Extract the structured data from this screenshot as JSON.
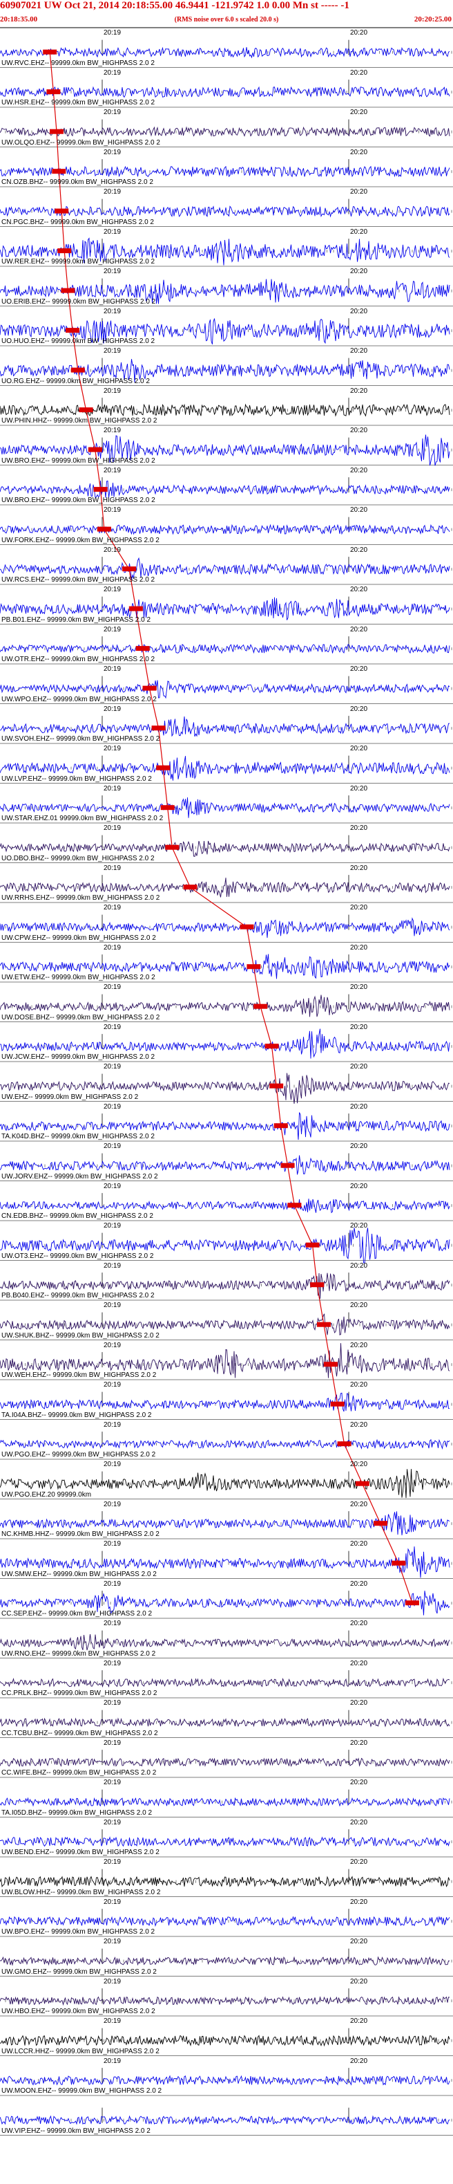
{
  "header": {
    "title": "60907021 UW Oct 21, 2014 20:18:55.00   46.9441 -121.9742   1.0 0.00 Mn st ----- -1",
    "start_time": "20:18:35.00",
    "note": "(RMS noise over 6.0 s scaled 20.0 s)",
    "end_time": "20:20:25.00"
  },
  "tick_labels": {
    "t1": "20:19",
    "t2": "20:20"
  },
  "colors": {
    "trace_blue": "#0000ee",
    "trace_dark": "#2a0f5e",
    "trace_black": "#000000",
    "pick_red": "#dd0000",
    "text_red": "#d40000"
  },
  "channels": [
    {
      "label": "UW.RVC.EHZ-- 99999.0km BW_HIGHPASS  2.0  2",
      "color": "blue",
      "amp": 0.35,
      "bursts": [
        [
          0.56,
          0.1
        ]
      ],
      "pick": 0.11,
      "tick1_label": false
    },
    {
      "label": "UW.HSR.EHZ-- 99999.0km BW_HIGHPASS  2.0  2",
      "color": "blue",
      "amp": 0.4,
      "bursts": [],
      "pick": 0.118,
      "tick1_label": false
    },
    {
      "label": "UW.OLQO.EHZ-- 99999.0km BW_HIGHPASS  2.0  2",
      "color": "dark",
      "amp": 0.35,
      "bursts": [],
      "pick": 0.125,
      "tick1_label": false
    },
    {
      "label": "CN.OZB.BHZ-- 99999.0km BW_HIGHPASS  2.0  2",
      "color": "blue",
      "amp": 0.4,
      "bursts": [],
      "pick": 0.13,
      "tick1_label": false
    },
    {
      "label": "CN.PGC.BHZ-- 99999.0km BW_HIGHPASS  2.0  2",
      "color": "blue",
      "amp": 0.4,
      "bursts": [],
      "pick": 0.136,
      "tick1_label": false
    },
    {
      "label": "UW.RER.EHZ-- 99999.0km BW_HIGHPASS  2.0  2",
      "color": "blue",
      "amp": 0.55,
      "bursts": [
        [
          0.2,
          0.5
        ],
        [
          0.5,
          0.6
        ],
        [
          0.8,
          0.5
        ]
      ],
      "pick": 0.142,
      "tick1_label": false
    },
    {
      "label": "UO.ERIB.EHZ-- 99999.0km BW_HIGHPASS  2.0  2",
      "color": "blue",
      "amp": 0.5,
      "bursts": [
        [
          0.35,
          0.6
        ],
        [
          0.6,
          0.5
        ],
        [
          0.9,
          0.5
        ]
      ],
      "pick": 0.15,
      "tick1_label": false
    },
    {
      "label": "UO.HUO.EHZ-- 99999.0km BW_HIGHPASS  2.0  2",
      "color": "blue",
      "amp": 0.55,
      "bursts": [
        [
          0.22,
          0.6
        ],
        [
          0.48,
          0.6
        ],
        [
          0.72,
          0.5
        ]
      ],
      "pick": 0.16,
      "tick1_label": false
    },
    {
      "label": "UO.RG.EHZ-- 99999.0km BW_HIGHPASS  2.0  2",
      "color": "blue",
      "amp": 0.5,
      "bursts": [
        [
          0.3,
          0.5
        ],
        [
          0.8,
          0.4
        ]
      ],
      "pick": 0.172,
      "tick1_label": false
    },
    {
      "label": "UW.PHIN.HHZ-- 99999.0km BW_HIGHPASS  2.0  2",
      "color": "black",
      "amp": 0.45,
      "bursts": [],
      "pick": 0.19,
      "tick1_label": false
    },
    {
      "label": "UW.BRO.EHZ-- 99999.0km BW_HIGHPASS  2.0  2",
      "color": "blue",
      "amp": 0.45,
      "bursts": [
        [
          0.26,
          0.9
        ],
        [
          0.95,
          0.9
        ]
      ],
      "pick": 0.21,
      "tick1_label": false
    },
    {
      "label": "UW.BRO.EHZ-- 99999.0km BW_HIGHPASS  2.0  2",
      "color": "blue",
      "amp": 0.35,
      "bursts": [
        [
          0.22,
          0.5
        ]
      ],
      "pick": 0.222,
      "tick1_label": false
    },
    {
      "label": "UW.FORK.EHZ-- 99999.0km BW_HIGHPASS  2.0  2",
      "color": "blue",
      "amp": 0.35,
      "bursts": [],
      "pick": 0.23,
      "tick1_label": false
    },
    {
      "label": "UW.RCS.EHZ-- 99999.0km BW_HIGHPASS  2.0  2",
      "color": "blue",
      "amp": 0.4,
      "bursts": [
        [
          0.3,
          0.5
        ]
      ],
      "pick": 0.285,
      "tick1_label": false
    },
    {
      "label": "PB.B01.EHZ-- 99999.0km BW_HIGHPASS  2.0  2",
      "color": "blue",
      "amp": 0.45,
      "bursts": [
        [
          0.3,
          0.4
        ],
        [
          0.62,
          0.6
        ],
        [
          0.75,
          0.5
        ]
      ],
      "pick": 0.3,
      "tick1_label": false
    },
    {
      "label": "UW.OTR.EHZ-- 99999.0km BW_HIGHPASS  2.0  2",
      "color": "blue",
      "amp": 0.35,
      "bursts": [],
      "pick": 0.315,
      "tick1_label": false
    },
    {
      "label": "UW.WPO.EHZ-- 99999.0km BW_HIGHPASS  2.0  2",
      "color": "blue",
      "amp": 0.35,
      "bursts": [
        [
          0.36,
          0.5
        ]
      ],
      "pick": 0.33,
      "tick1_label": false
    },
    {
      "label": "UW.SVOH.EHZ-- 99999.0km BW_HIGHPASS  2.0  2",
      "color": "blue",
      "amp": 0.4,
      "bursts": [
        [
          0.4,
          0.6
        ]
      ],
      "pick": 0.35,
      "tick1_label": false
    },
    {
      "label": "UW.LVP.EHZ-- 99999.0km BW_HIGHPASS  2.0  2",
      "color": "blue",
      "amp": 0.45,
      "bursts": [
        [
          0.4,
          0.8
        ]
      ],
      "pick": 0.36,
      "tick1_label": false
    },
    {
      "label": "UW.STAR.EHZ.01 99999.0km BW_HIGHPASS  2.0  2",
      "color": "blue",
      "amp": 0.35,
      "bursts": [
        [
          0.42,
          0.5
        ]
      ],
      "pick": 0.37,
      "tick1_label": false
    },
    {
      "label": "UO.DBO.BHZ-- 99999.0km BW_HIGHPASS  2.0  2",
      "color": "dark",
      "amp": 0.35,
      "bursts": [
        [
          0.43,
          0.4
        ]
      ],
      "pick": 0.38,
      "tick1_label": false
    },
    {
      "label": "UW.RRHS.EHZ-- 99999.0km BW_HIGHPASS  2.0  2",
      "color": "dark",
      "amp": 0.4,
      "bursts": [
        [
          0.5,
          0.5
        ]
      ],
      "pick": 0.42,
      "tick1_label": false
    },
    {
      "label": "UW.CPW.EHZ-- 99999.0km BW_HIGHPASS  2.0  2",
      "color": "blue",
      "amp": 0.4,
      "bursts": [
        [
          0.6,
          0.5
        ],
        [
          0.9,
          0.4
        ]
      ],
      "pick": 0.545,
      "tick1_label": false
    },
    {
      "label": "UW.ETW.EHZ-- 99999.0km BW_HIGHPASS  2.0  2",
      "color": "blue",
      "amp": 0.45,
      "bursts": [
        [
          0.6,
          0.6
        ],
        [
          0.7,
          0.5
        ]
      ],
      "pick": 0.56,
      "tick1_label": false
    },
    {
      "label": "UW.DOSE.BHZ-- 99999.0km BW_HIGHPASS  2.0  2",
      "color": "dark",
      "amp": 0.4,
      "bursts": [
        [
          0.7,
          0.6
        ]
      ],
      "pick": 0.575,
      "tick1_label": false
    },
    {
      "label": "UW.JCW.EHZ-- 99999.0km BW_HIGHPASS  2.0  2",
      "color": "blue",
      "amp": 0.4,
      "bursts": [
        [
          0.7,
          1.2
        ]
      ],
      "pick": 0.6,
      "tick1_label": false
    },
    {
      "label": "UW.EHZ-- 99999.0km BW_HIGHPASS  2.0  2",
      "color": "dark",
      "amp": 0.4,
      "bursts": [
        [
          0.65,
          1.0
        ]
      ],
      "pick": 0.61,
      "tick1_label": false
    },
    {
      "label": "TA.K04D.BHZ-- 99999.0km BW_HIGHPASS  2.0  2",
      "color": "blue",
      "amp": 0.4,
      "bursts": [
        [
          0.66,
          0.9
        ]
      ],
      "pick": 0.62,
      "tick1_label": false
    },
    {
      "label": "UW.JORV.EHZ-- 99999.0km BW_HIGHPASS  2.0  2",
      "color": "blue",
      "amp": 0.4,
      "bursts": [
        [
          0.67,
          0.6
        ]
      ],
      "pick": 0.635,
      "tick1_label": false
    },
    {
      "label": "CN.EDB.BHZ-- 99999.0km BW_HIGHPASS  2.0  2",
      "color": "blue",
      "amp": 0.35,
      "bursts": [
        [
          0.7,
          0.5
        ]
      ],
      "pick": 0.65,
      "tick1_label": false
    },
    {
      "label": "UW.OT3.EHZ-- 99999.0km BW_HIGHPASS  2.0  2",
      "color": "blue",
      "amp": 0.5,
      "bursts": [
        [
          0.8,
          1.4
        ]
      ],
      "pick": 0.69,
      "tick1_label": false
    },
    {
      "label": "PB.B040.EHZ-- 99999.0km BW_HIGHPASS  2.0  2",
      "color": "dark",
      "amp": 0.4,
      "bursts": [
        [
          0.72,
          0.8
        ]
      ],
      "pick": 0.7,
      "tick1_label": false
    },
    {
      "label": "UW.SHUK.BHZ-- 99999.0km BW_HIGHPASS  2.0  2",
      "color": "dark",
      "amp": 0.4,
      "bursts": [
        [
          0.73,
          0.6
        ]
      ],
      "pick": 0.715,
      "tick1_label": false
    },
    {
      "label": "UW.WEH.EHZ-- 99999.0km BW_HIGHPASS  2.0  2",
      "color": "dark",
      "amp": 0.55,
      "bursts": [
        [
          0.5,
          1.0
        ],
        [
          0.75,
          1.3
        ]
      ],
      "pick": 0.73,
      "tick1_label": false
    },
    {
      "label": "TA.I04A.BHZ-- 99999.0km BW_HIGHPASS  2.0  2",
      "color": "blue",
      "amp": 0.4,
      "bursts": [
        [
          0.75,
          0.6
        ]
      ],
      "pick": 0.745,
      "tick1_label": false
    },
    {
      "label": "UW.PGO.EHZ-- 99999.0km BW_HIGHPASS  2.0  2",
      "color": "blue",
      "amp": 0.35,
      "bursts": [],
      "pick": 0.76,
      "tick1_label": false
    },
    {
      "label": "UW.PGO.EHZ.20 99999.0km",
      "color": "black",
      "amp": 0.45,
      "bursts": [
        [
          0.45,
          0.7
        ],
        [
          0.9,
          0.8
        ]
      ],
      "pick": 0.8,
      "tick1_label": false
    },
    {
      "label": "NC.KHMB.HHZ-- 99999.0km BW_HIGHPASS  2.0  2",
      "color": "blue",
      "amp": 0.4,
      "bursts": [
        [
          0.88,
          0.6
        ]
      ],
      "pick": 0.84,
      "tick1_label": false
    },
    {
      "label": "UW.SMW.EHZ-- 99999.0km BW_HIGHPASS  2.0  2",
      "color": "blue",
      "amp": 0.45,
      "bursts": [
        [
          0.92,
          1.0
        ]
      ],
      "pick": 0.88,
      "tick1_label": false
    },
    {
      "label": "CC.SEP.EHZ-- 99999.0km BW_HIGHPASS  2.0  2",
      "color": "blue",
      "amp": 0.4,
      "bursts": [
        [
          0.24,
          0.7
        ],
        [
          0.94,
          0.8
        ]
      ],
      "pick": 0.91,
      "tick1_label": false
    },
    {
      "label": "UW.RNO.EHZ-- 99999.0km BW_HIGHPASS  2.0  2",
      "color": "dark",
      "amp": 0.35,
      "bursts": [
        [
          0.2,
          0.5
        ]
      ],
      "pick": null,
      "tick1_label": true
    },
    {
      "label": "CC.PRLK.BHZ-- 99999.0km BW_HIGHPASS  2.0  2",
      "color": "dark",
      "amp": 0.35,
      "bursts": [],
      "pick": null,
      "tick1_label": true
    },
    {
      "label": "CC.TCBU.BHZ-- 99999.0km BW_HIGHPASS  2.0  2",
      "color": "dark",
      "amp": 0.35,
      "bursts": [],
      "pick": null,
      "tick1_label": true
    },
    {
      "label": "CC.WIFE.BHZ-- 99999.0km BW_HIGHPASS  2.0  2",
      "color": "dark",
      "amp": 0.35,
      "bursts": [],
      "pick": null,
      "tick1_label": true
    },
    {
      "label": "TA.I05D.BHZ-- 99999.0km BW_HIGHPASS  2.0  2",
      "color": "blue",
      "amp": 0.35,
      "bursts": [],
      "pick": null,
      "tick1_label": true
    },
    {
      "label": "UW.BEND.EHZ-- 99999.0km BW_HIGHPASS  2.0  2",
      "color": "blue",
      "amp": 0.4,
      "bursts": [],
      "pick": null,
      "tick1_label": true
    },
    {
      "label": "UW.BLOW.HHZ-- 99999.0km BW_HIGHPASS  2.0  2",
      "color": "black",
      "amp": 0.45,
      "bursts": [],
      "pick": null,
      "tick1_label": true
    },
    {
      "label": "UW.BPO.EHZ-- 99999.0km BW_HIGHPASS  2.0  2",
      "color": "blue",
      "amp": 0.4,
      "bursts": [],
      "pick": null,
      "tick1_label": true
    },
    {
      "label": "UW.GMO.EHZ-- 99999.0km BW_HIGHPASS  2.0  2",
      "color": "dark",
      "amp": 0.35,
      "bursts": [],
      "pick": null,
      "tick1_label": true
    },
    {
      "label": "UW.HBO.EHZ-- 99999.0km BW_HIGHPASS  2.0  2",
      "color": "dark",
      "amp": 0.35,
      "bursts": [],
      "pick": null,
      "tick1_label": true
    },
    {
      "label": "UW.LCCR.HHZ-- 99999.0km BW_HIGHPASS  2.0  2",
      "color": "black",
      "amp": 0.45,
      "bursts": [],
      "pick": null,
      "tick1_label": true
    },
    {
      "label": "UW.MOON.EHZ-- 99999.0km BW_HIGHPASS  2.0  2",
      "color": "blue",
      "amp": 0.4,
      "bursts": [],
      "pick": null,
      "tick1_label": true
    },
    {
      "label": "UW.VIP.EHZ-- 99999.0km BW_HIGHPASS  2.0  2",
      "color": "blue",
      "amp": 0.35,
      "bursts": [],
      "pick": null,
      "tick1_label": false
    }
  ]
}
